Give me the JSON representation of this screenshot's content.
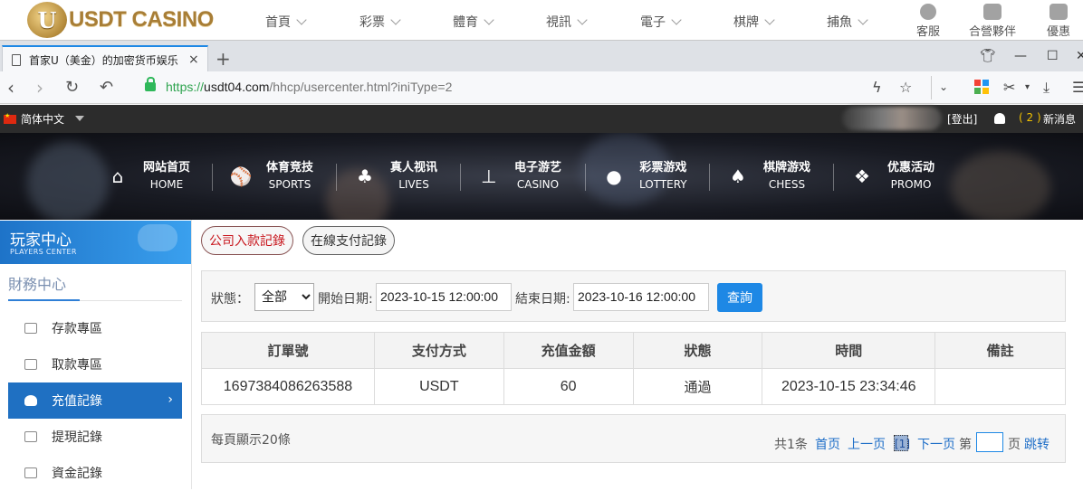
{
  "site_header": {
    "logo_letter": "U",
    "brand": "USDT CASINO",
    "menu": [
      "首頁",
      "彩票",
      "體育",
      "視訊",
      "電子",
      "棋牌",
      "捕魚"
    ],
    "right_items": [
      {
        "label": "客服",
        "icon": "chat-icon"
      },
      {
        "label": "合營夥伴",
        "icon": "partners-icon"
      },
      {
        "label": "優惠",
        "icon": "gift-icon"
      }
    ]
  },
  "browser": {
    "tab_title": "首家U（美金）的加密货币娱乐",
    "tab_close": "×",
    "new_tab": "+",
    "url_scheme": "https://",
    "url_host": "usdt04.com",
    "url_path": "/hhcp/usercenter.html?iniType=2"
  },
  "topbar": {
    "language": "简体中文",
    "logout": "[登出]",
    "message_count": "( 2 )",
    "messages_label": "新消息"
  },
  "main_nav": [
    {
      "cn": "网站首页",
      "en": "HOME",
      "icon": "home-icon"
    },
    {
      "cn": "体育竞技",
      "en": "SPORTS",
      "icon": "ball-icon"
    },
    {
      "cn": "真人视讯",
      "en": "LIVES",
      "icon": "cards-icon"
    },
    {
      "cn": "电子游艺",
      "en": "CASINO",
      "icon": "joystick-icon"
    },
    {
      "cn": "彩票游戏",
      "en": "LOTTERY",
      "icon": "lottery-balls-icon"
    },
    {
      "cn": "棋牌游戏",
      "en": "CHESS",
      "icon": "spade-icon"
    },
    {
      "cn": "优惠活动",
      "en": "PROMO",
      "icon": "gift-icon"
    }
  ],
  "sidebar": {
    "header_cn": "玩家中心",
    "header_en": "PLAYERS CENTER",
    "section": "財務中心",
    "items": [
      {
        "label": "存款專區",
        "icon": "deposit-icon",
        "active": false
      },
      {
        "label": "取款專區",
        "icon": "withdraw-icon",
        "active": false
      },
      {
        "label": "充值記錄",
        "icon": "moneybag-icon",
        "active": true
      },
      {
        "label": "提現記錄",
        "icon": "wallet-icon",
        "active": false
      },
      {
        "label": "資金記錄",
        "icon": "funds-icon",
        "active": false
      }
    ]
  },
  "record_tabs": [
    "公司入款記錄",
    "在線支付記錄"
  ],
  "filter": {
    "status_label": "狀態：",
    "status_value": "全部",
    "start_label": "開始日期:",
    "start_value": "2023-10-15 12:00:00",
    "end_label": "結束日期:",
    "end_value": "2023-10-16 12:00:00",
    "query_button": "查詢"
  },
  "table": {
    "headers": [
      "訂單號",
      "支付方式",
      "充值金額",
      "狀態",
      "時間",
      "備註"
    ],
    "rows": [
      [
        "1697384086263588",
        "USDT",
        "60",
        "通過",
        "2023-10-15 23:34:46",
        ""
      ]
    ]
  },
  "pager": {
    "per_page": "每頁顯示20條",
    "total": "共1条",
    "first": "首页",
    "prev": "上一页",
    "current": "[1]",
    "next": "下一页",
    "goto_prefix": "第",
    "goto_suffix": "页",
    "jump": "跳转"
  },
  "colors": {
    "accent_blue": "#1e88e5",
    "sidebar_active": "#1f70c2",
    "url_green": "#2fa44f",
    "tab_red": "#c8161d",
    "message_yellow": "#f2c200"
  }
}
